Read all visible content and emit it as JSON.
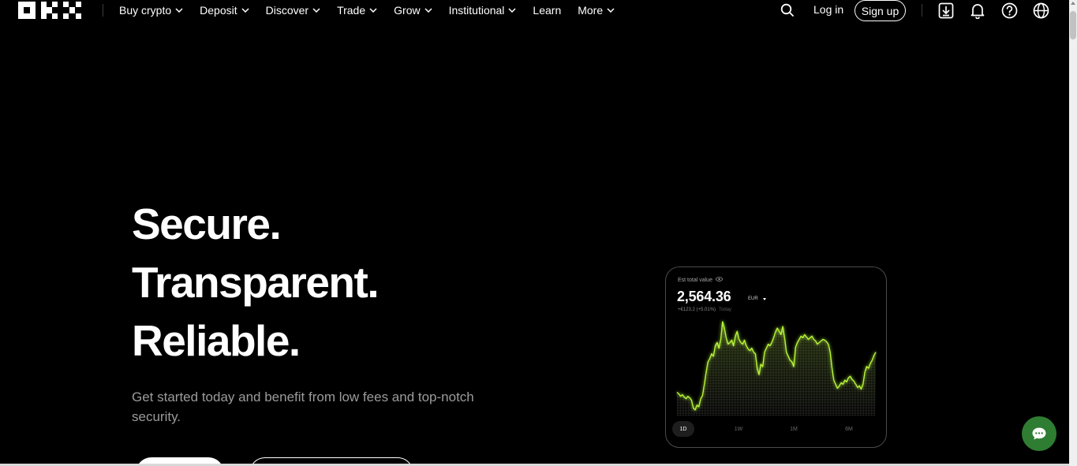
{
  "nav": {
    "logo": "OKX logo",
    "menu": [
      {
        "label": "Buy crypto",
        "has_dropdown": true
      },
      {
        "label": "Deposit",
        "has_dropdown": true
      },
      {
        "label": "Discover",
        "has_dropdown": true
      },
      {
        "label": "Trade",
        "has_dropdown": true
      },
      {
        "label": "Grow",
        "has_dropdown": true
      },
      {
        "label": "Institutional",
        "has_dropdown": true
      },
      {
        "label": "Learn",
        "has_dropdown": false
      },
      {
        "label": "More",
        "has_dropdown": true
      }
    ],
    "login_label": "Log in",
    "signup_label": "Sign up",
    "icons": [
      "search-icon",
      "download-icon",
      "bell-icon",
      "help-icon",
      "globe-icon"
    ]
  },
  "hero": {
    "headline_1": "Secure.",
    "headline_2": "Transparent.",
    "headline_3": "Reliable.",
    "subtitle": "Get started today and benefit from low fees and top-notch security."
  },
  "card": {
    "est_label": "Est total value",
    "balance": "2,564.36",
    "currency": "EUR",
    "change": "+€123.2 (+5.01%)",
    "change_period": "Today",
    "ranges": [
      "1D",
      "1W",
      "1M",
      "6M"
    ],
    "active_range": "1D"
  },
  "chart_data": {
    "type": "area",
    "title": "",
    "xlabel": "",
    "ylabel": "",
    "series": [
      {
        "values": [
          30,
          28,
          25,
          27,
          24,
          22,
          25,
          23,
          20,
          10,
          8,
          14,
          12,
          22,
          26,
          40,
          55,
          68,
          72,
          78,
          75,
          88,
          92,
          85,
          96,
          118,
          110,
          98,
          90,
          92,
          95,
          88,
          100,
          106,
          96,
          92,
          90,
          95,
          88,
          84,
          82,
          85,
          80,
          78,
          60,
          52,
          65,
          62,
          80,
          85,
          90,
          88,
          92,
          98,
          105,
          110,
          106,
          102,
          112,
          98,
          80,
          75,
          70,
          68,
          62,
          86,
          92,
          96,
          100,
          98,
          102,
          99,
          96,
          98,
          100,
          96,
          94,
          90,
          92,
          94,
          96,
          95,
          93,
          90,
          80,
          60,
          45,
          40,
          35,
          38,
          42,
          40,
          45,
          43,
          48,
          50,
          46,
          44,
          40,
          36,
          38,
          34,
          40,
          55,
          62,
          60,
          66,
          70,
          76,
          80
        ]
      }
    ]
  },
  "colors": {
    "background": "#000000",
    "accent_green": "#b6f537",
    "chat_bubble": "#2e7d32",
    "subtitle_gray": "#9b9b9b"
  }
}
